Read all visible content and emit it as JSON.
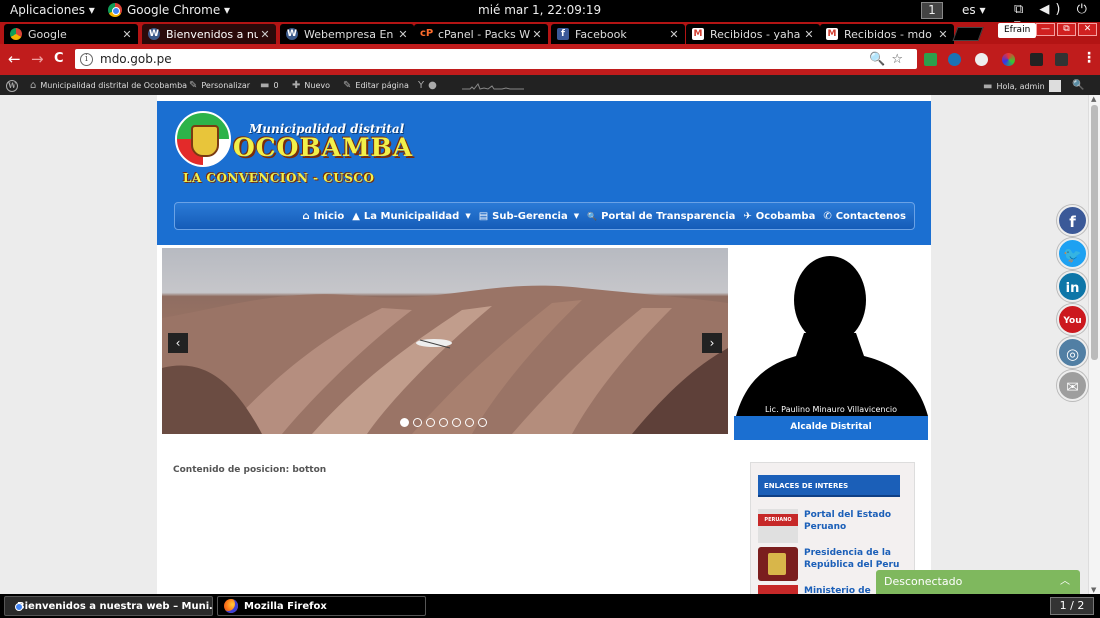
{
  "gnome_top": {
    "apps_label": "Aplicaciones ▾",
    "active_app": "Google Chrome ▾",
    "clock": "mié mar  1, 22:09:19",
    "workspace": "1",
    "lang": "es ▾",
    "sys_icons": "⧉ ◀) ⏻ ▾"
  },
  "tabs": [
    {
      "title": "Google",
      "icon": "google-icon"
    },
    {
      "title": "Bienvenidos a nu",
      "icon": "wordpress-icon"
    },
    {
      "title": "Webempresa En",
      "icon": "wordpress-icon"
    },
    {
      "title": "cPanel - Packs W",
      "icon": "cpanel-icon"
    },
    {
      "title": "Facebook",
      "icon": "facebook-icon"
    },
    {
      "title": "Recibidos - yaha",
      "icon": "gmail-icon"
    },
    {
      "title": "Recibidos - mdo",
      "icon": "gmail-icon"
    }
  ],
  "tab_close": "✕",
  "profile_name": "Efrain",
  "window_buttons": [
    "—",
    "⧉",
    "✕"
  ],
  "toolbar": {
    "back": "←",
    "forward": "→",
    "reload": "C",
    "url": "mdo.gob.pe",
    "info_glyph": "i",
    "omnibox_icons": "🔍☆",
    "menu": "⋮"
  },
  "adminbar": {
    "site_name": "Municipalidad distrital de Ocobamba",
    "customize": "Personalizar",
    "comments": "0",
    "new": "Nuevo",
    "edit": "Editar página",
    "greeting": "Hola, admin"
  },
  "site": {
    "logo_line1": "Municipalidad distrital",
    "logo_line2": "OCOBAMBA",
    "logo_line3": "LA CONVENCION - CUSCO",
    "nav": [
      {
        "label": "Inicio",
        "icon": "home-icon",
        "glyph": "⌂",
        "dropdown": false
      },
      {
        "label": "La Municipalidad",
        "icon": "institution-icon",
        "glyph": "▲",
        "dropdown": true
      },
      {
        "label": "Sub-Gerencia",
        "icon": "list-icon",
        "glyph": "▤",
        "dropdown": true
      },
      {
        "label": "Portal de Transparencia",
        "icon": "search-icon",
        "glyph": "🔍",
        "dropdown": false
      },
      {
        "label": "Ocobamba",
        "icon": "tourism-icon",
        "glyph": "✈",
        "dropdown": false
      },
      {
        "label": "Contactenos",
        "icon": "phone-icon",
        "glyph": "✆",
        "dropdown": false
      }
    ],
    "slider": {
      "prev": "‹",
      "next": "›",
      "total_slides": 7,
      "active_slide": 1
    },
    "mayor_name": "Lic. Paulino Minauro Villavicencio",
    "mayor_title": "Alcalde Distrital",
    "content_label": "Contenido de posicion: botton",
    "sidebar_title": "ENLACES DE INTERES",
    "links": [
      {
        "title": "Portal del Estado Peruano",
        "thumb_label": "PERUANO"
      },
      {
        "title": "Presidencia de la República del Peru",
        "thumb_label": ""
      },
      {
        "title": "Ministerio de",
        "thumb_label": ""
      }
    ]
  },
  "socials": [
    {
      "name": "facebook-icon",
      "glyph": "f",
      "color": "#3b5998"
    },
    {
      "name": "twitter-icon",
      "glyph": "🐦",
      "color": "#1da1f2"
    },
    {
      "name": "linkedin-icon",
      "glyph": "in",
      "color": "#0e76a8"
    },
    {
      "name": "youtube-icon",
      "glyph": "You",
      "color": "#cc181e"
    },
    {
      "name": "instagram-icon",
      "glyph": "◎",
      "color": "#517fa4"
    },
    {
      "name": "email-icon",
      "glyph": "✉",
      "color": "#9e9e9e"
    }
  ],
  "chat_status": "Desconectado",
  "taskbar": {
    "tasks": [
      {
        "title": "Bienvenidos a nuestra web – Muni…",
        "icon": "chrome-icon"
      },
      {
        "title": "Mozilla Firefox",
        "icon": "firefox-icon"
      }
    ],
    "pager": "1 / 2"
  },
  "colors": {
    "brand_blue": "#1b6fd1",
    "chrome_red": "#c01c1c",
    "chat_green": "#7fb85e"
  }
}
